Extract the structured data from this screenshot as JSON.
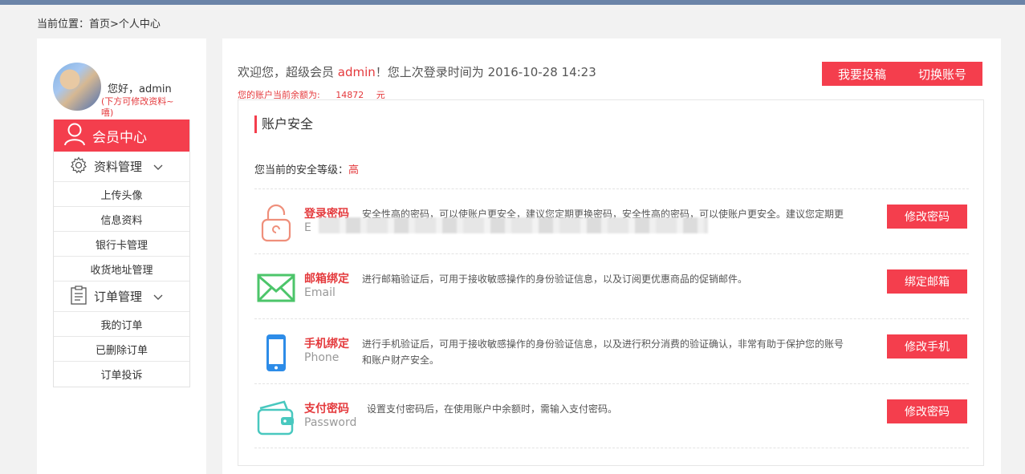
{
  "breadcrumb": "当前位置：首页>个人中心",
  "profile": {
    "greeting": "您好，admin",
    "edit_hint": "(下方可修改资料~嘻)"
  },
  "nav": {
    "header": "会员中心",
    "groups": [
      {
        "label": "资料管理",
        "icon": "gear-icon",
        "items": [
          "上传头像",
          "信息资料",
          "银行卡管理",
          "收货地址管理"
        ]
      },
      {
        "label": "订单管理",
        "icon": "clipboard-icon",
        "items": [
          "我的订单",
          "已删除订单",
          "订单投诉"
        ]
      }
    ]
  },
  "welcome": {
    "prefix": "欢迎您，超级会员",
    "username": "admin",
    "suffix": "！您上次登录时间为",
    "last_login": "2016-10-28 14:23"
  },
  "balance": {
    "label": "您的账户当前余额为:",
    "amount": "14872",
    "unit": "元"
  },
  "top_buttons": {
    "submit": "我要投稿",
    "switch": "切换账号"
  },
  "security": {
    "title": "账户安全",
    "level_label": "您当前的安全等级：",
    "level_value": "高",
    "rows": [
      {
        "title": "登录密码",
        "sub": "E",
        "desc": "安全性高的密码，可以使账户更安全，建议您定期更换密码，安全性高的密码，可以使账户更安全。建议您定期更",
        "button": "修改密码",
        "icon": "lock-icon"
      },
      {
        "title": "邮箱绑定",
        "sub": "Email",
        "desc": "进行邮箱验证后，可用于接收敏感操作的身份验证信息，以及订阅更优惠商品的促销邮件。",
        "button": "绑定邮箱",
        "icon": "envelope-icon"
      },
      {
        "title": "手机绑定",
        "sub": "Phone",
        "desc": "进行手机验证后，可用于接收敏感操作的身份验证信息，以及进行积分消费的验证确认，非常有助于保护您的账号和账户财产安全。",
        "button": "修改手机",
        "icon": "phone-icon"
      },
      {
        "title": "支付密码",
        "sub": "Password",
        "desc": "设置支付密码后，在使用账户中余额时，需输入支付密码。",
        "button": "修改密码",
        "icon": "wallet-icon"
      }
    ]
  },
  "colors": {
    "accent": "#f43e4d",
    "topbar": "#6b84a8"
  }
}
